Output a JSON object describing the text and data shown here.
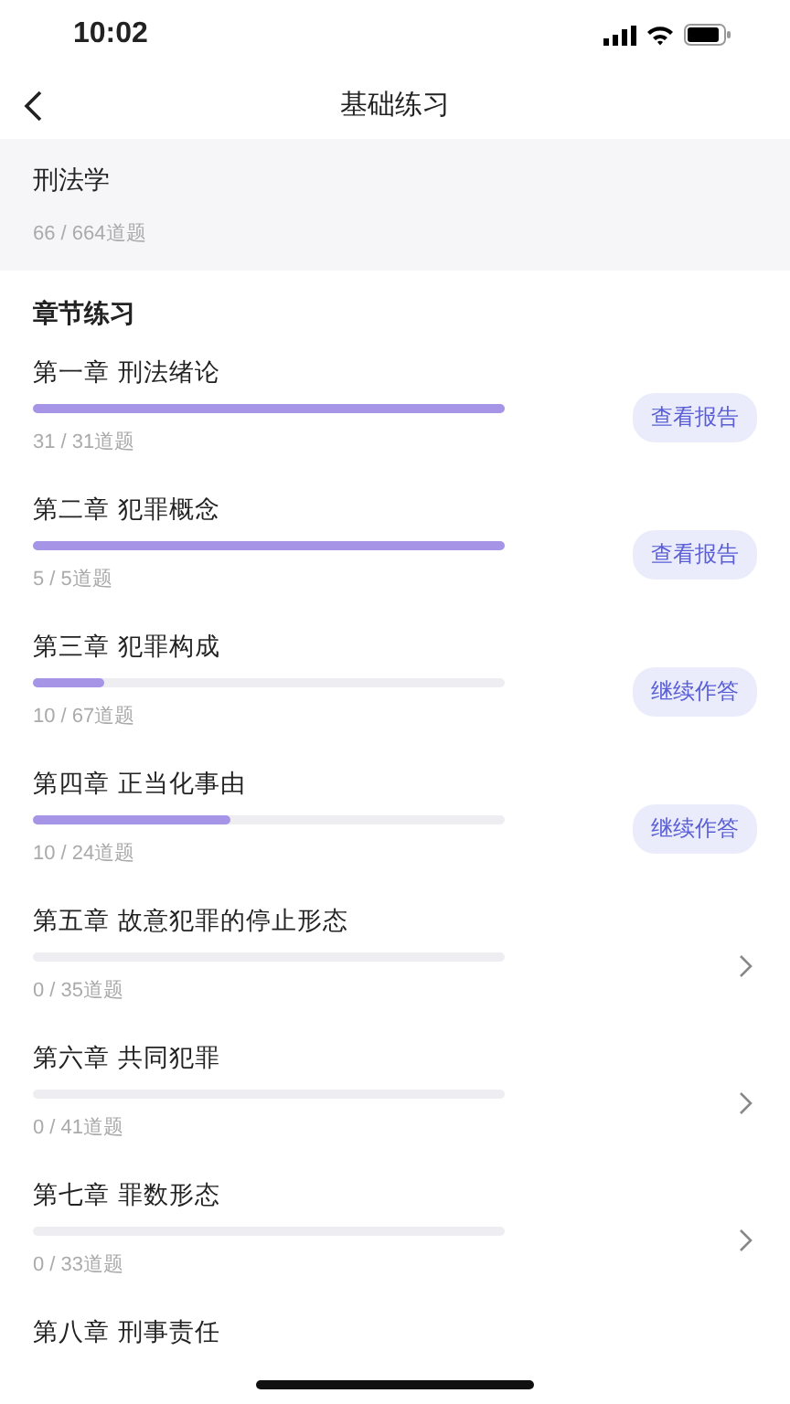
{
  "status_bar": {
    "time": "10:02"
  },
  "nav": {
    "title": "基础练习"
  },
  "subject": {
    "name": "刑法学",
    "count": "66 / 664道题"
  },
  "section_title": "章节练习",
  "chapters": [
    {
      "title": "第一章 刑法绪论",
      "level": 1,
      "count": "31 / 31道题",
      "action": {
        "kind": "button",
        "label": "查看报告"
      }
    },
    {
      "title": "第二章 犯罪概念",
      "level": 1,
      "count": "5 / 5道题",
      "action": {
        "kind": "button",
        "label": "查看报告"
      }
    },
    {
      "title": "第三章 犯罪构成",
      "level": 0.15,
      "count": "10 / 67道题",
      "action": {
        "kind": "button",
        "label": "继续作答"
      }
    },
    {
      "title": "第四章 正当化事由",
      "level": 0.42,
      "count": "10 / 24道题",
      "action": {
        "kind": "button",
        "label": "继续作答"
      }
    },
    {
      "title": "第五章 故意犯罪的停止形态",
      "level": 0,
      "count": "0 / 35道题",
      "action": {
        "kind": "arrow"
      }
    },
    {
      "title": "第六章 共同犯罪",
      "level": 0,
      "count": "0 / 41道题",
      "action": {
        "kind": "arrow"
      }
    },
    {
      "title": "第七章 罪数形态",
      "level": 0,
      "count": "0 / 33道题",
      "action": {
        "kind": "arrow"
      }
    },
    {
      "title": "第八章 刑事责任"
    }
  ]
}
